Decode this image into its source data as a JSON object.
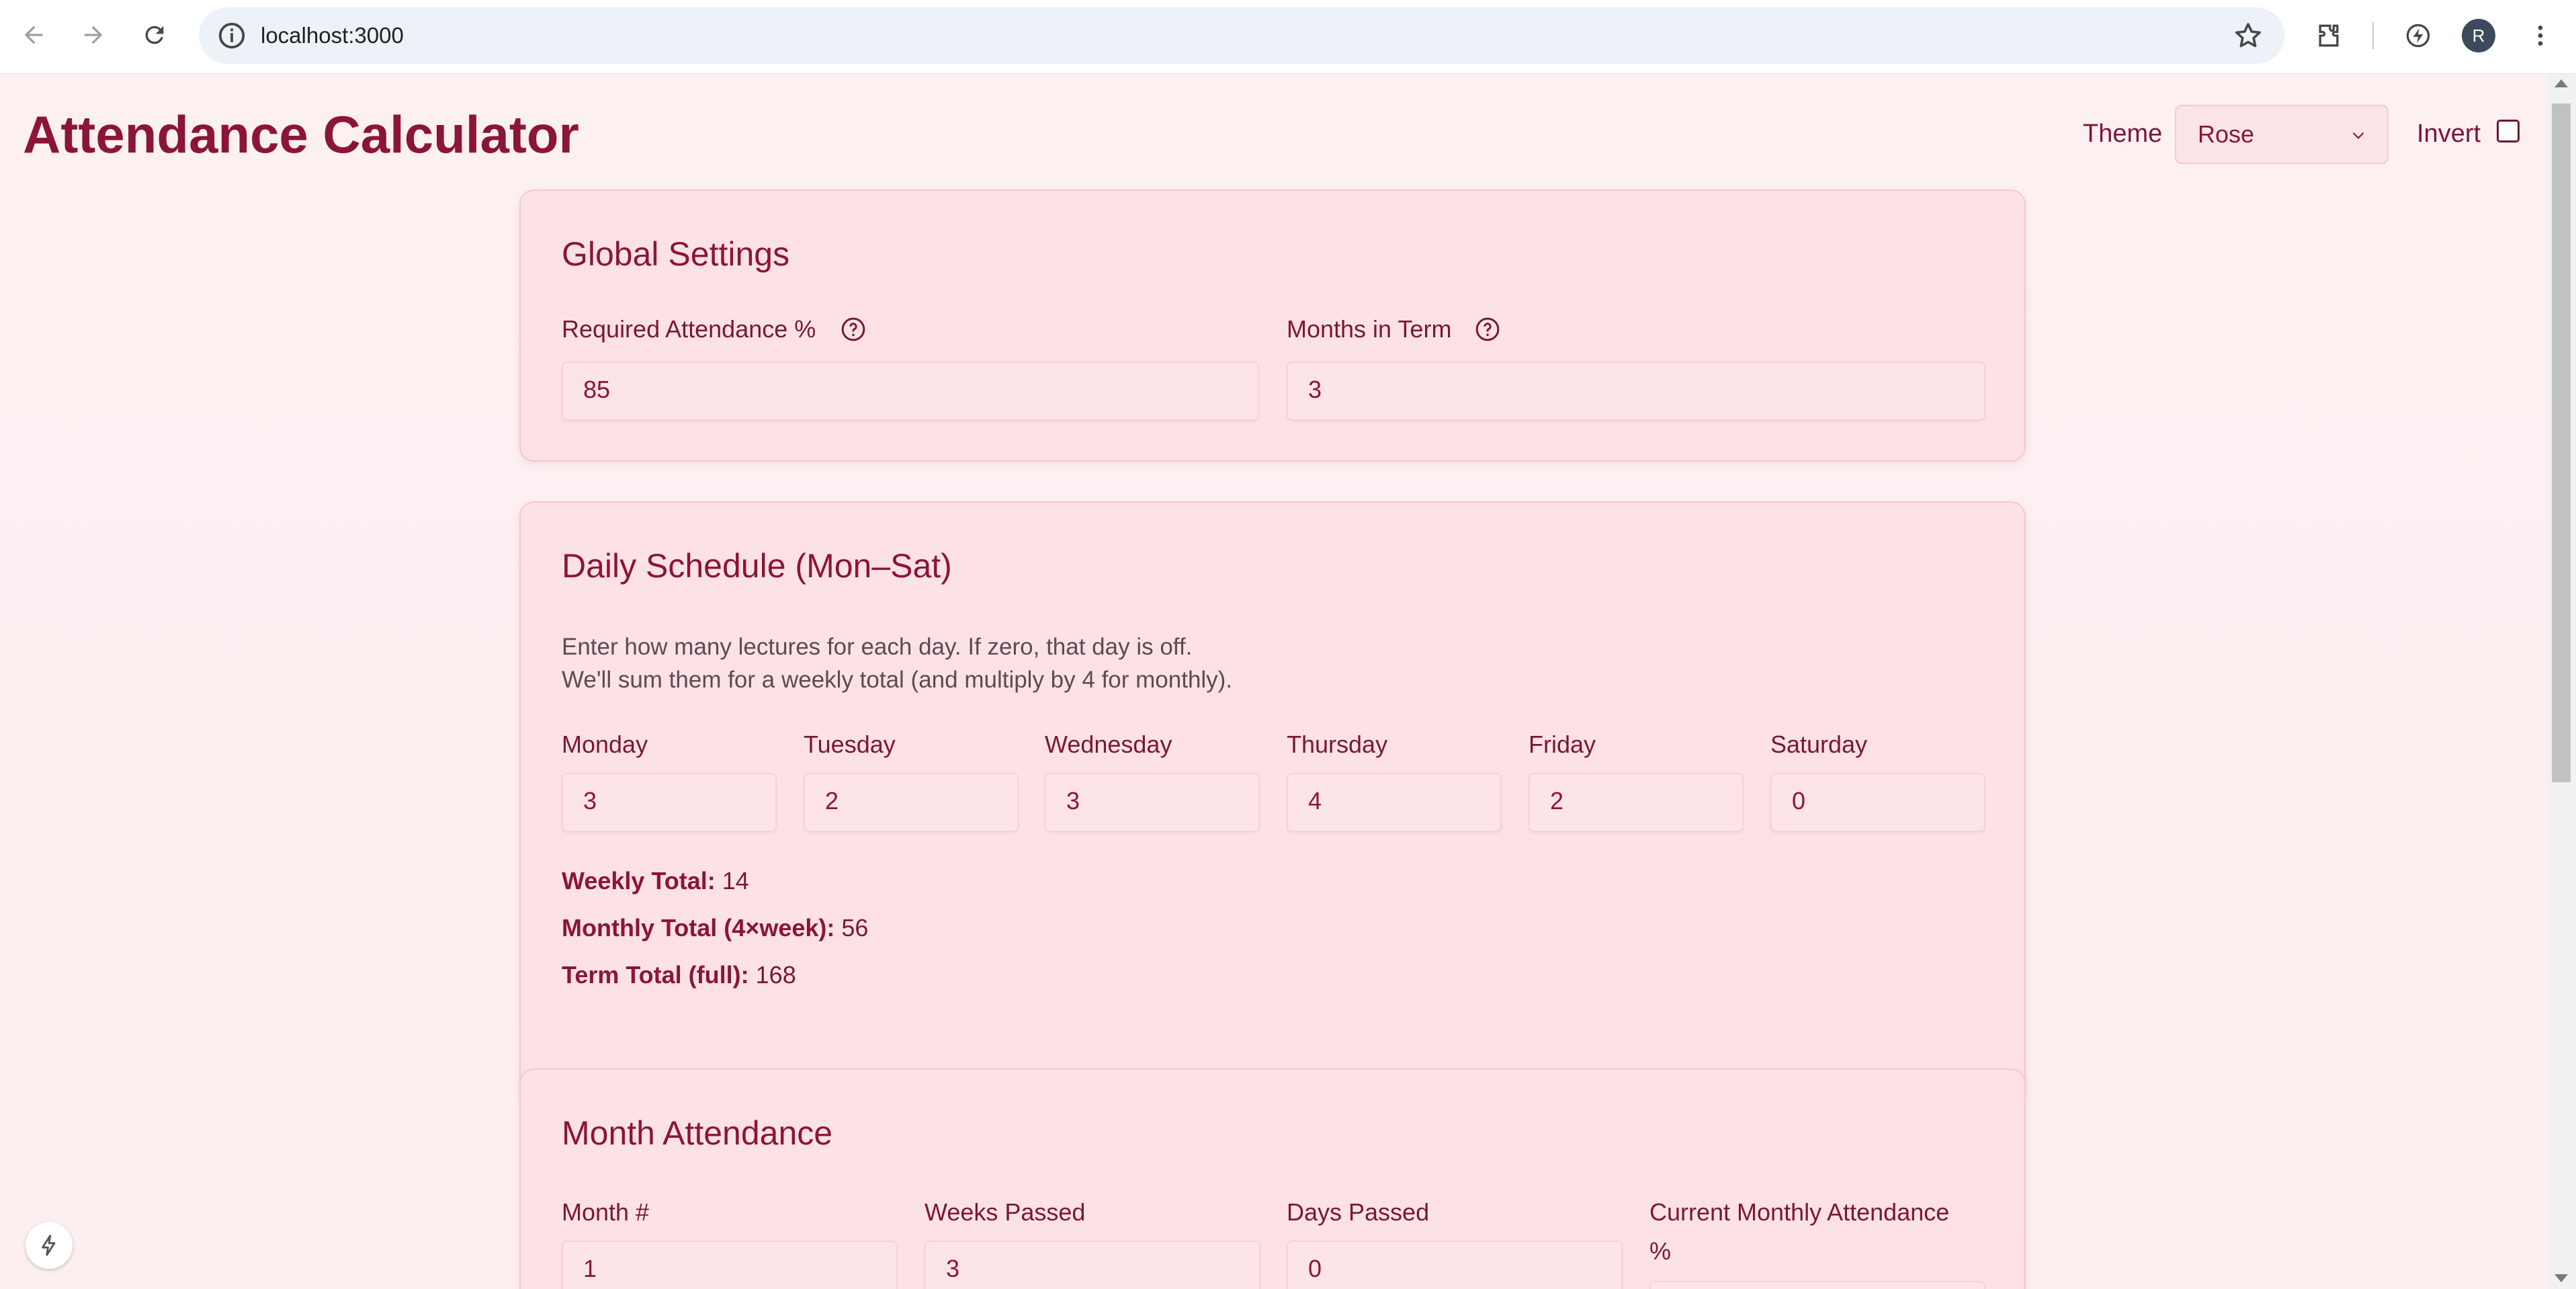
{
  "browser": {
    "url": "localhost:3000",
    "profile_initial": "R",
    "icons": [
      "back-icon",
      "forward-icon",
      "reload-icon",
      "site-info-icon",
      "bookmark-star-icon",
      "extensions-icon",
      "performance-icon",
      "menu-dots-icon"
    ]
  },
  "header": {
    "title": "Attendance Calculator",
    "theme_label": "Theme",
    "theme_value": "Rose",
    "invert_label": "Invert",
    "invert_checked": false
  },
  "global_settings": {
    "title": "Global Settings",
    "required_label": "Required Attendance %",
    "required_value": "85",
    "months_label": "Months in Term",
    "months_value": "3"
  },
  "daily_schedule": {
    "title": "Daily Schedule (Mon–Sat)",
    "desc_line1": "Enter how many lectures for each day. If zero, that day is off.",
    "desc_line2": "We'll sum them for a weekly total (and multiply by 4 for monthly).",
    "days": [
      {
        "label": "Monday",
        "value": "3"
      },
      {
        "label": "Tuesday",
        "value": "2"
      },
      {
        "label": "Wednesday",
        "value": "3"
      },
      {
        "label": "Thursday",
        "value": "4"
      },
      {
        "label": "Friday",
        "value": "2"
      },
      {
        "label": "Saturday",
        "value": "0"
      }
    ],
    "weekly_label": "Weekly Total:",
    "weekly_value": "14",
    "monthly_label": "Monthly Total (4×week):",
    "monthly_value": "56",
    "term_label": "Term Total (full):",
    "term_value": "168"
  },
  "month_attendance": {
    "title": "Month Attendance",
    "month_label": "Month #",
    "month_value": "1",
    "weeks_label": "Weeks Passed",
    "weeks_value": "3",
    "days_label": "Days Passed",
    "days_value": "0",
    "current_label_line1": "Current Monthly Attendance",
    "current_label_line2": "%"
  },
  "colors": {
    "accent": "#8b1538",
    "card_bg": "#fde2e5",
    "page_bg": "#fdeef0"
  }
}
